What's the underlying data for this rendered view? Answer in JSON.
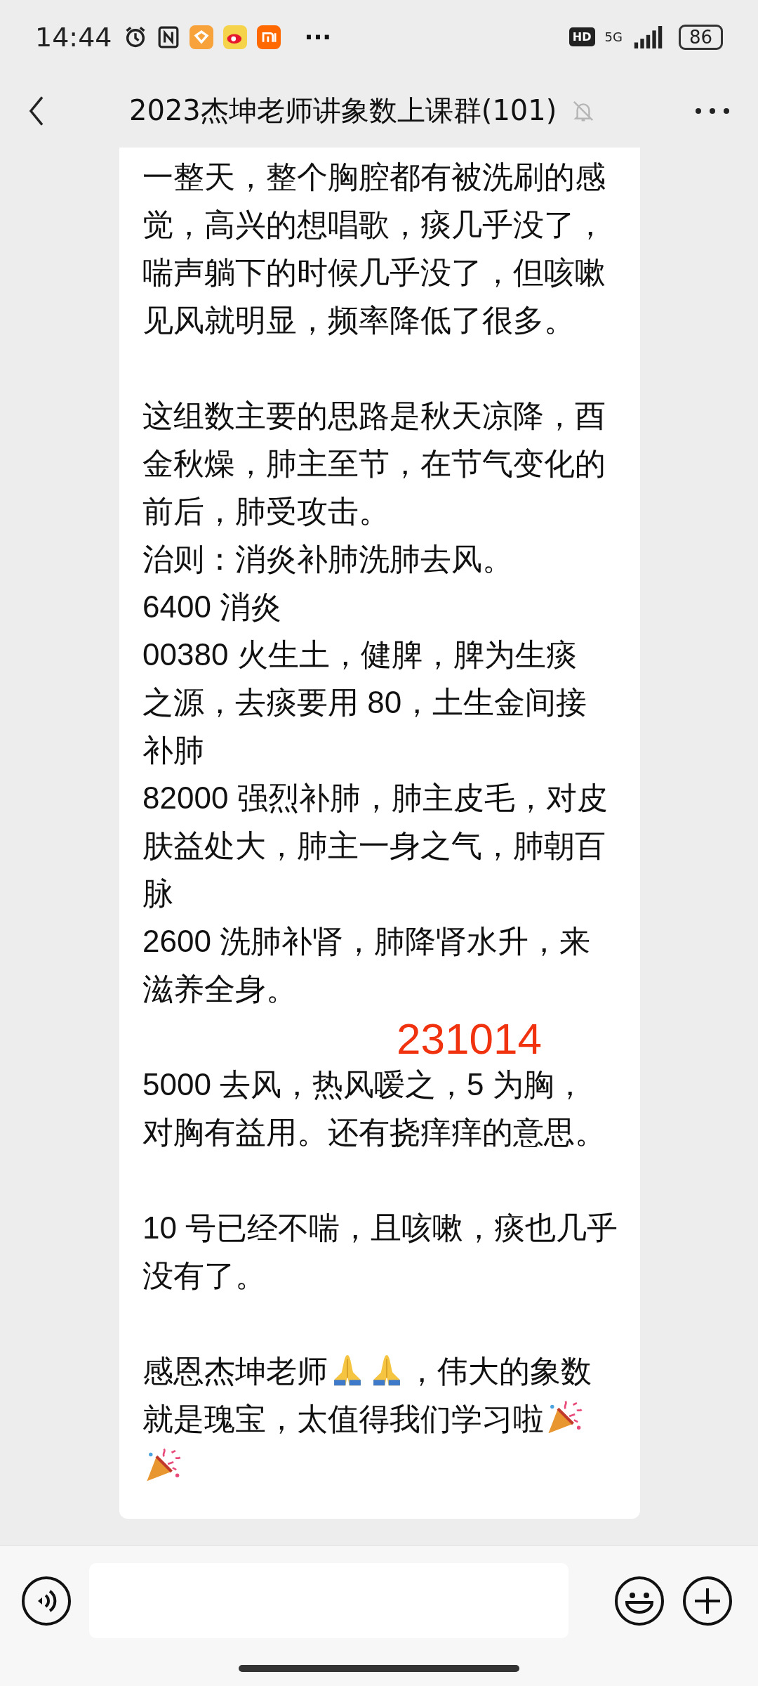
{
  "status_bar": {
    "time": "14:44",
    "more": "···",
    "hd": "HD",
    "network": "5G",
    "battery": "86"
  },
  "header": {
    "title": "2023杰坤老师讲象数上课群(101)",
    "muted": true
  },
  "message": {
    "blocks": [
      {
        "lines": [
          {
            "text": "一整天，整个胸腔都有被洗刷的感"
          },
          {
            "text": "觉，高兴的想唱歌，痰几乎没了，"
          },
          {
            "text": "喘声躺下的时候几乎没了，但咳嗽"
          },
          {
            "text": "见风就明显，频率降低了很多。"
          }
        ]
      },
      {
        "lines": [
          {
            "text": "这组数主要的思路是秋天凉降，酉"
          },
          {
            "text": "金秋燥，肺主至节，在节气变化的"
          },
          {
            "text": "前后，肺受攻击。"
          },
          {
            "text": "治则：消炎补肺洗肺去风。"
          },
          {
            "text": "6400 消炎"
          },
          {
            "text": "00380 火生土，健脾，脾为生痰"
          },
          {
            "text": "之源，去痰要用 80，土生金间接"
          },
          {
            "text": "补肺"
          },
          {
            "text": "82000 强烈补肺，肺主皮毛，对皮"
          },
          {
            "text": "肤益处大，肺主一身之气，肺朝百"
          },
          {
            "text": "脉"
          },
          {
            "text": "2600 洗肺补肾，肺降肾水升，来"
          },
          {
            "text": "滋养全身。"
          }
        ]
      },
      {
        "lines": [
          {
            "text": "5000 去风，热风嗳之，5 为胸，"
          },
          {
            "text": "对胸有益用。还有挠痒痒的意思。"
          }
        ]
      },
      {
        "lines": [
          {
            "text": "10 号已经不喘，且咳嗽，痰也几乎"
          },
          {
            "text": "没有了。"
          }
        ]
      },
      {
        "lines": [
          {
            "parts": [
              {
                "kind": "text",
                "text": "感恩杰坤老师"
              },
              {
                "kind": "pray"
              },
              {
                "kind": "pray"
              },
              {
                "kind": "text",
                "text": "，伟大的象数"
              }
            ]
          },
          {
            "parts": [
              {
                "kind": "text",
                "text": "就是瑰宝，太值得我们学习啦"
              },
              {
                "kind": "party"
              }
            ]
          },
          {
            "parts": [
              {
                "kind": "party"
              }
            ]
          }
        ]
      }
    ],
    "stamp": "231014"
  }
}
